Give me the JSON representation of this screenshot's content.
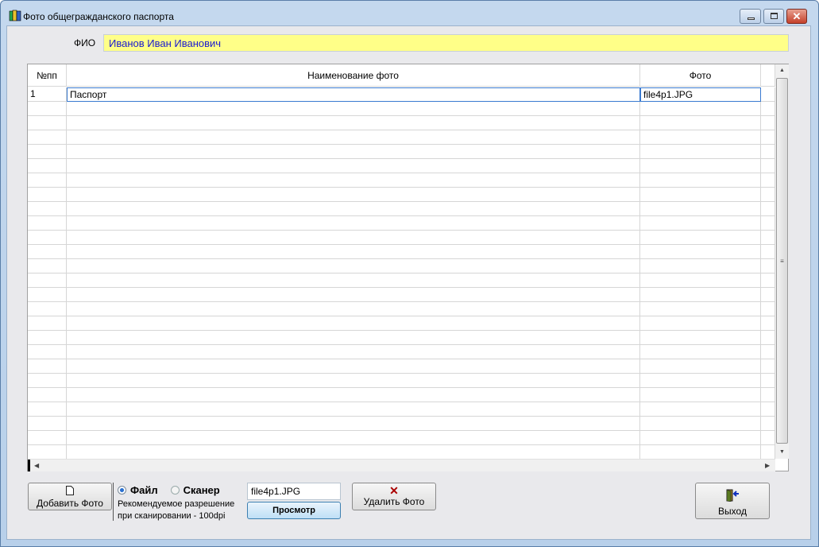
{
  "window": {
    "title": "Фото общегражданского паспорта"
  },
  "form": {
    "fio_label": "ФИО",
    "fio_value": "Иванов Иван Иванович"
  },
  "table": {
    "columns": [
      "№пп",
      "Наименование фото",
      "Фото"
    ],
    "rows": [
      {
        "num": "1",
        "name": "Паспорт",
        "photo": "file4p1.JPG"
      }
    ]
  },
  "bottom": {
    "add_label": "Добавить Фото",
    "source_file": "Файл",
    "source_scanner": "Сканер",
    "selected_source": "Файл",
    "hint_line1": "Рекомендуемое разрешение",
    "hint_line2": "при сканировании - 100dpi",
    "file_value": "file4p1.JPG",
    "view_label": "Просмотр",
    "delete_label": "Удалить Фото",
    "exit_label": "Выход"
  }
}
